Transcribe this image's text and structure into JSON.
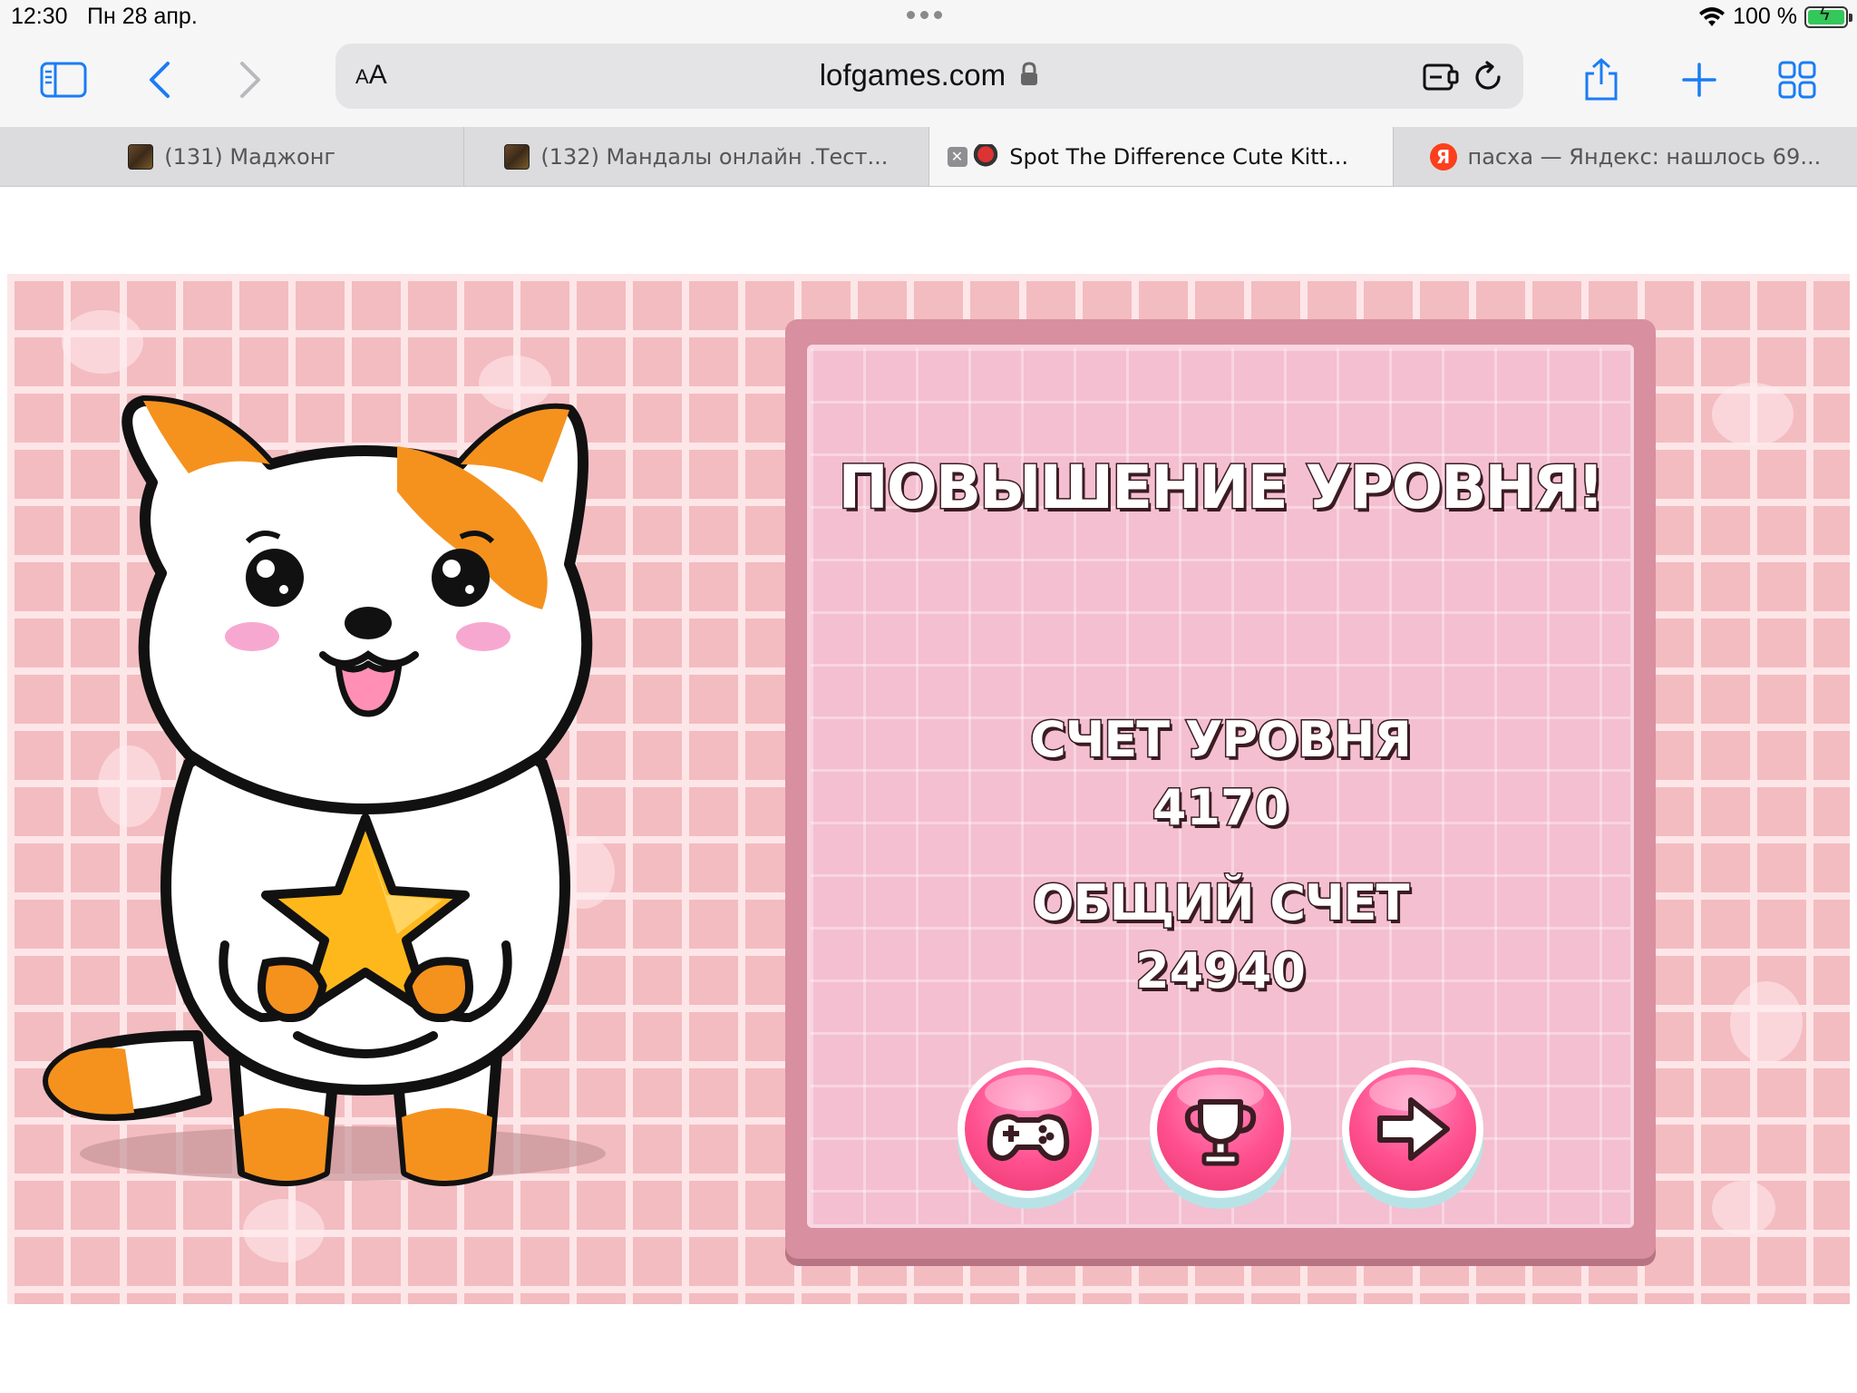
{
  "status": {
    "time": "12:30",
    "date": "Пн 28 апр.",
    "battery": "100 %"
  },
  "browser": {
    "aa_small": "A",
    "aa_large": "A",
    "url": "lofgames.com"
  },
  "tabs": [
    {
      "label": "(131) Маджонг",
      "favicon": "mahjong-favicon"
    },
    {
      "label": "(132) Мандалы онлайн .Тест...",
      "favicon": "mahjong-favicon"
    },
    {
      "label": "Spot The Difference Cute Kitt...",
      "favicon": "cat-favicon",
      "active": true
    },
    {
      "label": "пасха — Яндекс: нашлось 69...",
      "favicon": "yandex-favicon",
      "favicon_letter": "Я"
    }
  ],
  "game": {
    "title": "ПОВЫШЕНИЕ УРОВНЯ!",
    "level_score_label": "СЧЕТ УРОВНЯ",
    "level_score": "4170",
    "total_score_label": "ОБЩИЙ СЧЕТ",
    "total_score": "24940",
    "buttons": [
      {
        "icon": "gamepad-icon"
      },
      {
        "icon": "trophy-icon"
      },
      {
        "icon": "arrow-right-icon"
      }
    ],
    "colors": {
      "background": "#f3bcc0",
      "panel": "#f4bfd1",
      "button": "#ff4f8e",
      "cat_orange": "#f5921e"
    }
  }
}
